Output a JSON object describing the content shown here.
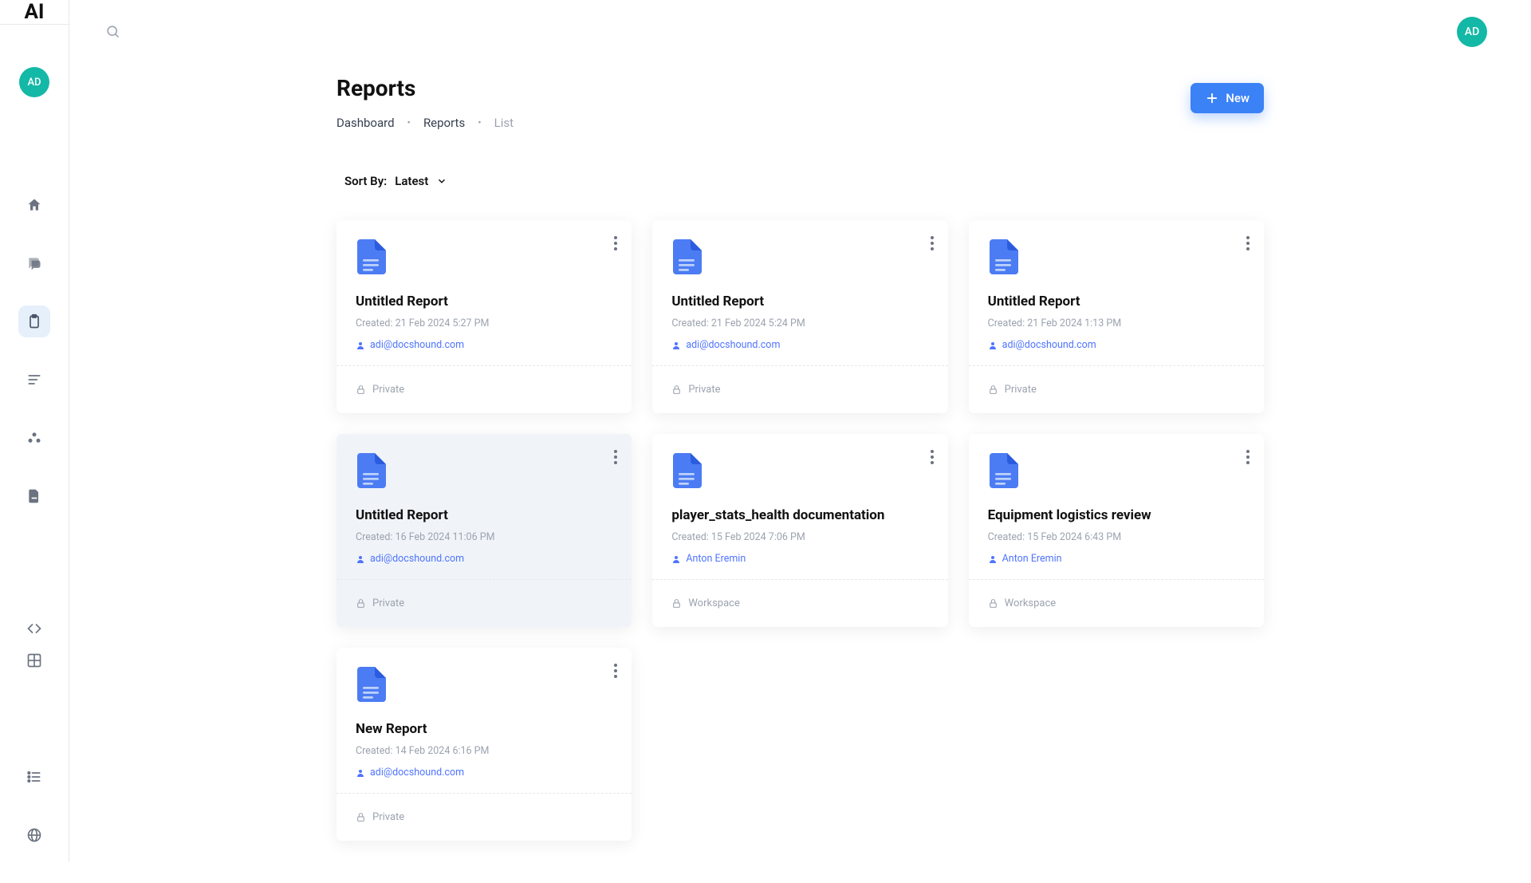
{
  "logo": "AI",
  "avatar_initials": "AD",
  "header": {
    "title": "Reports",
    "breadcrumb": [
      "Dashboard",
      "Reports",
      "List"
    ],
    "new_button": "New"
  },
  "sort": {
    "prefix": "Sort By: ",
    "value": "Latest"
  },
  "cards": [
    {
      "title": "Untitled Report",
      "created": "Created: 21 Feb 2024 5:27 PM",
      "author": "adi@docshound.com",
      "visibility": "Private",
      "selected": false
    },
    {
      "title": "Untitled Report",
      "created": "Created: 21 Feb 2024 5:24 PM",
      "author": "adi@docshound.com",
      "visibility": "Private",
      "selected": false
    },
    {
      "title": "Untitled Report",
      "created": "Created: 21 Feb 2024 1:13 PM",
      "author": "adi@docshound.com",
      "visibility": "Private",
      "selected": false
    },
    {
      "title": "Untitled Report",
      "created": "Created: 16 Feb 2024 11:06 PM",
      "author": "adi@docshound.com",
      "visibility": "Private",
      "selected": true
    },
    {
      "title": "player_stats_health documentation",
      "created": "Created: 15 Feb 2024 7:06 PM",
      "author": "Anton Eremin",
      "visibility": "Workspace",
      "selected": false
    },
    {
      "title": "Equipment logistics review",
      "created": "Created: 15 Feb 2024 6:43 PM",
      "author": "Anton Eremin",
      "visibility": "Workspace",
      "selected": false
    },
    {
      "title": "New Report",
      "created": "Created: 14 Feb 2024 6:16 PM",
      "author": "adi@docshound.com",
      "visibility": "Private",
      "selected": false
    }
  ],
  "side_nav": [
    {
      "name": "home",
      "active": false
    },
    {
      "name": "chat",
      "active": false
    },
    {
      "name": "reports",
      "active": true
    },
    {
      "name": "notes",
      "active": false
    },
    {
      "name": "team",
      "active": false
    },
    {
      "name": "files",
      "active": false
    }
  ],
  "side_nav_lower": [
    {
      "name": "code"
    }
  ],
  "side_nav_bottom": [
    {
      "name": "grid"
    },
    {
      "name": "list"
    },
    {
      "name": "globe"
    }
  ]
}
